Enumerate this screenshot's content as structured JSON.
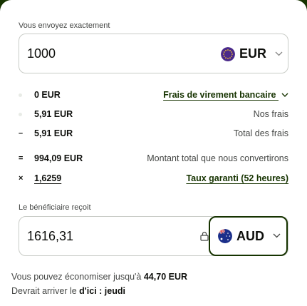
{
  "send": {
    "label": "Vous envoyez exactement",
    "amount": "1000",
    "currency": "EUR"
  },
  "fees": {
    "rows": [
      {
        "symbol": "",
        "value": "0 EUR",
        "desc": "Frais de virement bancaire",
        "desc_is_link": true
      },
      {
        "symbol": "",
        "value": "5,91 EUR",
        "desc": "Nos frais",
        "desc_is_link": false
      },
      {
        "symbol": "–",
        "value": "5,91 EUR",
        "desc": "Total des frais",
        "desc_is_link": false
      },
      {
        "symbol": "=",
        "value": "994,09 EUR",
        "desc": "Montant total que nous convertirons",
        "desc_is_link": false
      },
      {
        "symbol": "×",
        "value": "1,6259",
        "desc": "Taux garanti (52 heures)",
        "desc_is_link": true
      }
    ]
  },
  "receive": {
    "label": "Le bénéficiaire reçoit",
    "amount": "1616,31",
    "currency": "AUD"
  },
  "footer": {
    "savings_prefix": "Vous pouvez économiser jusqu'à",
    "savings_amount": "44,70 EUR",
    "arrival_prefix": "Devrait arriver le",
    "arrival_value": "d'ici : jeudi"
  },
  "colors": {
    "brand_dark_green": "#163300",
    "text": "#0e0f0c",
    "muted": "#454745"
  },
  "icons": {
    "eur_flag": "eu-flag-icon",
    "aud_flag": "australia-flag-icon",
    "chevron": "chevron-down-icon",
    "lock": "lock-icon"
  }
}
